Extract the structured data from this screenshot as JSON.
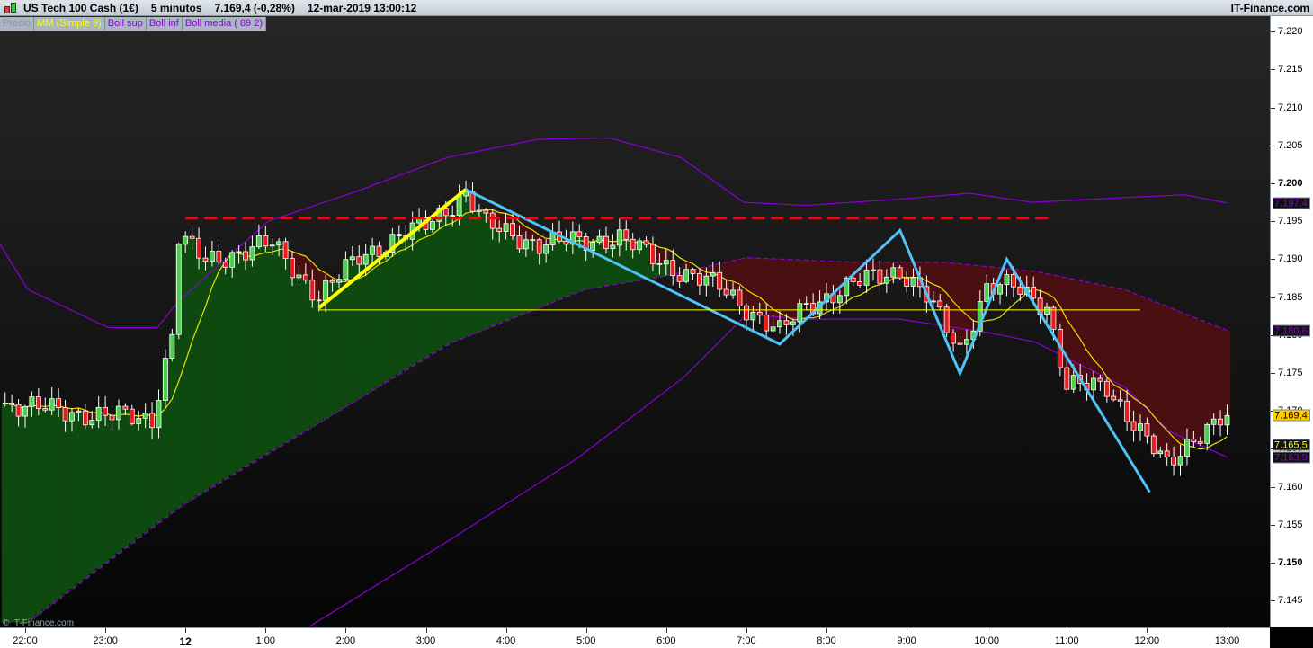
{
  "header": {
    "instrument": "US Tech 100 Cash (1€)",
    "timeframe": "5 minutos",
    "last_price": "7.169,4 (-0,28%)",
    "datetime": "12-mar-2019 13:00:12",
    "brand": "IT-Finance.com"
  },
  "legend": [
    {
      "label": "Precio",
      "color": "#8a949c"
    },
    {
      "label": "MM (Simple 9)",
      "color": "#ffff00"
    },
    {
      "label": "Boll sup",
      "color": "#8a00d4"
    },
    {
      "label": "Boll inf",
      "color": "#8a00d4"
    },
    {
      "label": "Boll media ( 89 2)",
      "color": "#8a00d4"
    }
  ],
  "copyright": "© IT-Finance.com",
  "price_tags": [
    {
      "label": "7.197,4",
      "value": 7197.4,
      "color": "#8a00d4",
      "bg": "#111111"
    },
    {
      "label": "7.180,6",
      "value": 7180.6,
      "color": "#8a00d4",
      "bg": "#111111"
    },
    {
      "label": "7.169,4",
      "value": 7169.4,
      "color": "#000000",
      "bg": "#ffcc00"
    },
    {
      "label": "7.165,5",
      "value": 7165.5,
      "color": "#ffff00",
      "bg": "#111111"
    },
    {
      "label": "7.163,9",
      "value": 7163.9,
      "color": "#8a00d4",
      "bg": "#111111"
    }
  ],
  "chart_data": {
    "type": "candlestick",
    "title": "US Tech 100 Cash (1€) 5 minutos",
    "bar_minutes": 5,
    "x_unit": "minutes since 22:00 (11-mar)",
    "ylim": [
      7141,
      7222
    ],
    "y_ticks": [
      {
        "v": 7220,
        "label": "7.220"
      },
      {
        "v": 7215,
        "label": "7.215"
      },
      {
        "v": 7210,
        "label": "7.210"
      },
      {
        "v": 7205,
        "label": "7.205"
      },
      {
        "v": 7200,
        "label": "7.200",
        "bold": true
      },
      {
        "v": 7195,
        "label": "7.195"
      },
      {
        "v": 7190,
        "label": "7.190"
      },
      {
        "v": 7185,
        "label": "7.185"
      },
      {
        "v": 7180,
        "label": "7.180"
      },
      {
        "v": 7175,
        "label": "7.175"
      },
      {
        "v": 7170,
        "label": "7.170"
      },
      {
        "v": 7165,
        "label": "7.165"
      },
      {
        "v": 7160,
        "label": "7.160"
      },
      {
        "v": 7155,
        "label": "7.155"
      },
      {
        "v": 7150,
        "label": "7.150",
        "bold": true
      },
      {
        "v": 7145,
        "label": "7.145"
      }
    ],
    "x_ticks": [
      {
        "t": 0,
        "label": "22:00"
      },
      {
        "t": 60,
        "label": "23:00"
      },
      {
        "t": 120,
        "label": "12",
        "bold": true
      },
      {
        "t": 180,
        "label": "1:00"
      },
      {
        "t": 240,
        "label": "2:00"
      },
      {
        "t": 300,
        "label": "3:00"
      },
      {
        "t": 360,
        "label": "4:00"
      },
      {
        "t": 420,
        "label": "5:00"
      },
      {
        "t": 480,
        "label": "6:00"
      },
      {
        "t": 540,
        "label": "7:00"
      },
      {
        "t": 600,
        "label": "8:00"
      },
      {
        "t": 660,
        "label": "9:00"
      },
      {
        "t": 720,
        "label": "10:00"
      },
      {
        "t": 780,
        "label": "11:00"
      },
      {
        "t": 840,
        "label": "12:00"
      },
      {
        "t": 900,
        "label": "13:00"
      }
    ],
    "close_path": [
      [
        -15,
        7170.9
      ],
      [
        55,
        7169.4
      ],
      [
        95,
        7169.0
      ],
      [
        110,
        7180.0
      ],
      [
        115,
        7192.8
      ],
      [
        135,
        7189.8
      ],
      [
        185,
        7192.0
      ],
      [
        220,
        7185.0
      ],
      [
        250,
        7190.4
      ],
      [
        300,
        7194.5
      ],
      [
        330,
        7198.7
      ],
      [
        345,
        7194.5
      ],
      [
        385,
        7192.0
      ],
      [
        445,
        7192.8
      ],
      [
        480,
        7189.2
      ],
      [
        520,
        7186.3
      ],
      [
        565,
        7180.3
      ],
      [
        585,
        7183.9
      ],
      [
        630,
        7187.4
      ],
      [
        655,
        7188.6
      ],
      [
        675,
        7185.0
      ],
      [
        700,
        7178.0
      ],
      [
        720,
        7186.3
      ],
      [
        740,
        7186.3
      ],
      [
        765,
        7183.9
      ],
      [
        780,
        7173.2
      ],
      [
        810,
        7173.2
      ],
      [
        845,
        7164.9
      ],
      [
        855,
        7162.6
      ],
      [
        875,
        7166.7
      ],
      [
        900,
        7169.4
      ]
    ],
    "boll_sup": [
      [
        -19,
        7192
      ],
      [
        2,
        7186
      ],
      [
        62,
        7181
      ],
      [
        99,
        7181
      ],
      [
        115,
        7184.5
      ],
      [
        182,
        7195
      ],
      [
        249,
        7199
      ],
      [
        316,
        7203.4
      ],
      [
        384,
        7205.8
      ],
      [
        437,
        7206
      ],
      [
        491,
        7203.4
      ],
      [
        538,
        7197.5
      ],
      [
        585,
        7197.1
      ],
      [
        653,
        7197.9
      ],
      [
        707,
        7198.7
      ],
      [
        754,
        7197.5
      ],
      [
        821,
        7198.1
      ],
      [
        868,
        7198.5
      ],
      [
        900,
        7197.4
      ]
    ],
    "boll_inf": [
      [
        213,
        7141.6
      ],
      [
        318,
        7153
      ],
      [
        413,
        7163.7
      ],
      [
        493,
        7174.4
      ],
      [
        540,
        7182.7
      ],
      [
        587,
        7182.1
      ],
      [
        655,
        7182.1
      ],
      [
        722,
        7180.3
      ],
      [
        756,
        7179.1
      ],
      [
        823,
        7173.2
      ],
      [
        857,
        7167.3
      ],
      [
        900,
        7163.9
      ]
    ],
    "boll_media": [
      [
        2,
        7142.1
      ],
      [
        117,
        7157.5
      ],
      [
        218,
        7168.2
      ],
      [
        318,
        7178.9
      ],
      [
        419,
        7186.0
      ],
      [
        480,
        7187.8
      ],
      [
        540,
        7190.2
      ],
      [
        621,
        7189.6
      ],
      [
        688,
        7189.6
      ],
      [
        756,
        7188.4
      ],
      [
        823,
        7186.0
      ],
      [
        900,
        7180.6
      ]
    ],
    "ma_period": 9,
    "last_values": {
      "price": 7169.4,
      "mm9": 7165.5,
      "boll_sup": 7197.4,
      "boll_media": 7180.6,
      "boll_inf": 7163.9
    },
    "drawings": [
      {
        "type": "trendline",
        "color": "#ffff00",
        "width": 4,
        "points": [
          [
            220,
            7183.6
          ],
          [
            330,
            7199.2
          ]
        ]
      },
      {
        "type": "polyline",
        "color": "#4fc3f7",
        "width": 3,
        "points": [
          [
            330,
            7199.2
          ],
          [
            565,
            7178.8
          ],
          [
            655,
            7193.8
          ],
          [
            700,
            7174.9
          ],
          [
            735,
            7190.0
          ],
          [
            842,
            7159.3
          ]
        ]
      },
      {
        "type": "hline",
        "color": "#ffff00",
        "width": 1,
        "price": 7183.3,
        "from": 220,
        "to": 835
      },
      {
        "type": "hline-dashed",
        "color": "#ff0000",
        "width": 3,
        "price": 7195.4,
        "from": 120,
        "to": 767
      }
    ]
  }
}
